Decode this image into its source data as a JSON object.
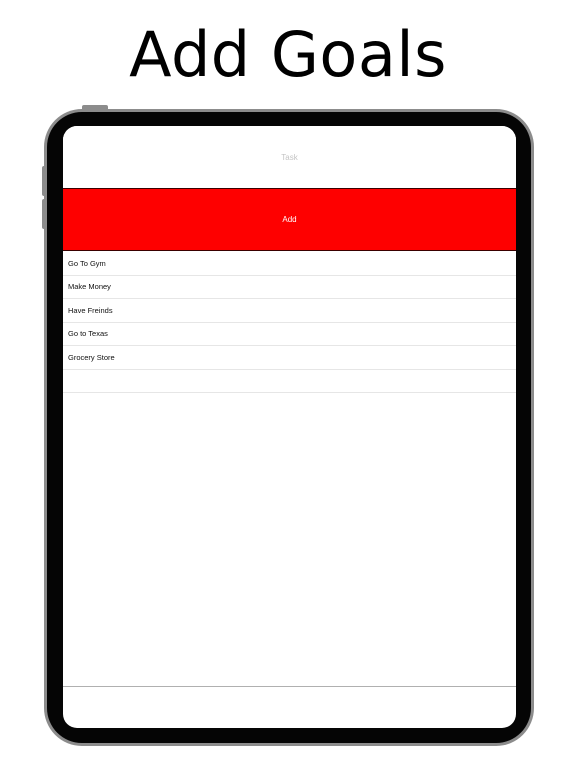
{
  "headline": "Add Goals",
  "task_input": {
    "placeholder": "Task",
    "value": ""
  },
  "add_button": {
    "label": "Add",
    "color": "#fe0000"
  },
  "goals": [
    "Go To Gym",
    "Make Money",
    "Have Freinds",
    "Go to Texas",
    "Grocery Store",
    ""
  ]
}
